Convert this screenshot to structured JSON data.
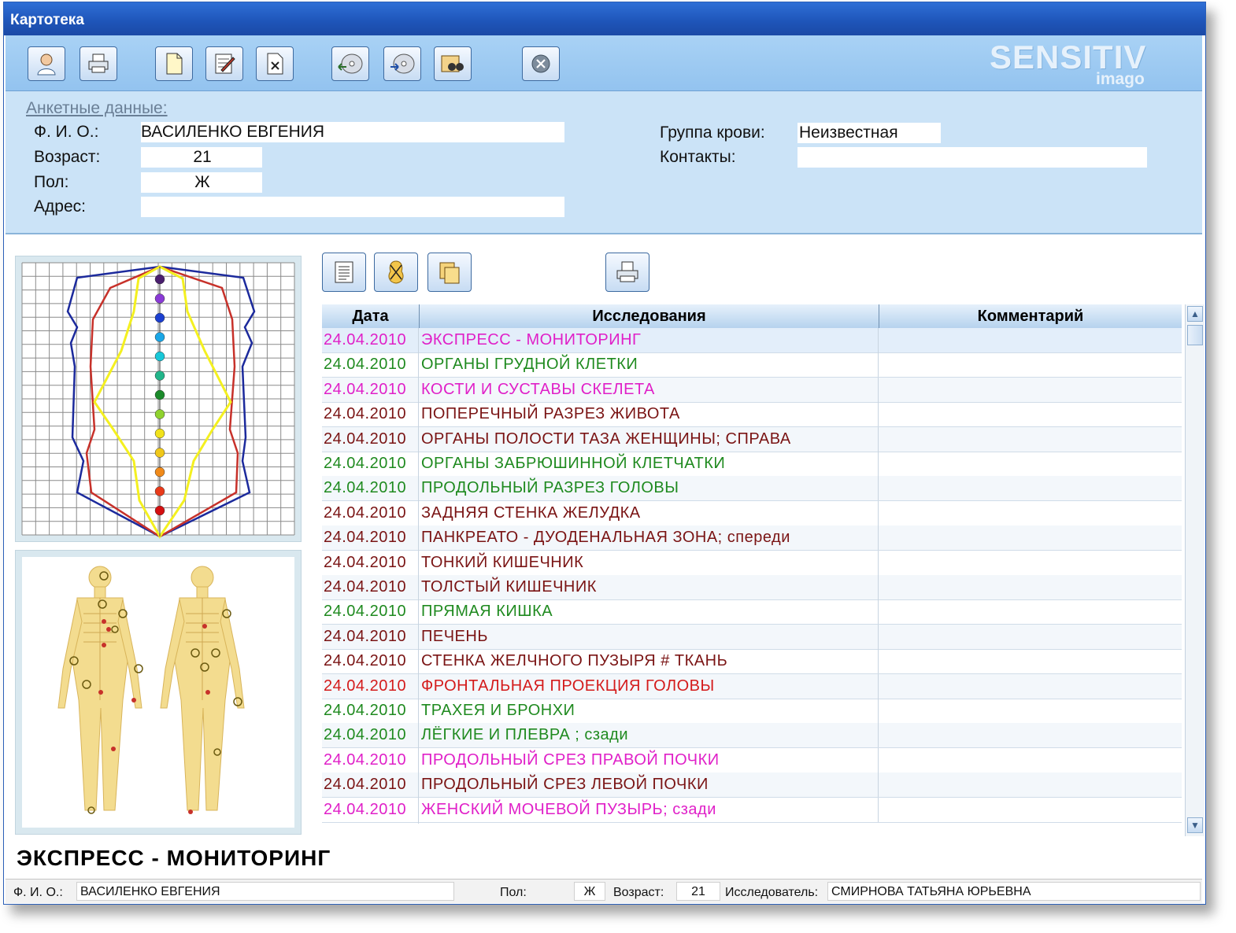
{
  "window": {
    "title": "Картотека"
  },
  "toolbar": {
    "buttons": [
      {
        "name": "patient-button",
        "icon": "person-icon"
      },
      {
        "name": "print-button",
        "icon": "printer-icon"
      },
      {
        "name": "new-button",
        "icon": "new-document-icon"
      },
      {
        "name": "edit-button",
        "icon": "edit-icon"
      },
      {
        "name": "delete-button",
        "icon": "delete-icon"
      },
      {
        "name": "import-button",
        "icon": "disk-import-icon"
      },
      {
        "name": "export-button",
        "icon": "disk-export-icon"
      },
      {
        "name": "search-button",
        "icon": "binoculars-icon"
      },
      {
        "name": "close-button",
        "icon": "close-icon"
      }
    ],
    "brand": "SENSITIV",
    "brand_sub": "imago"
  },
  "profile": {
    "section_title": "Анкетные данные:",
    "fio_label": "Ф. И. О.:",
    "fio_value": "ВАСИЛЕНКО ЕВГЕНИЯ",
    "age_label": "Возраст:",
    "age_value": "21",
    "sex_label": "Пол:",
    "sex_value": "Ж",
    "address_label": "Адрес:",
    "address_value": "",
    "blood_label": "Группа крови:",
    "blood_value": "Неизвестная",
    "contacts_label": "Контакты:",
    "contacts_value": ""
  },
  "detail_toolbar": {
    "buttons": [
      {
        "name": "list-button",
        "icon": "list-icon"
      },
      {
        "name": "body-button",
        "icon": "body-icon"
      },
      {
        "name": "copy-button",
        "icon": "copy-icon"
      },
      {
        "name": "print-study-button",
        "icon": "printer-icon"
      }
    ]
  },
  "table": {
    "headers": {
      "date": "Дата",
      "study": "Исследования",
      "comment": "Комментарий"
    },
    "rows": [
      {
        "date": "24.04.2010",
        "study": "ЭКСПРЕСС  -  МОНИТОРИНГ",
        "comment": "",
        "color": "#e020c8"
      },
      {
        "date": "24.04.2010",
        "study": "ОРГАНЫ  ГРУДНОЙ  КЛЕТКИ",
        "comment": "",
        "color": "#1f8a1f"
      },
      {
        "date": "24.04.2010",
        "study": "КОСТИ И СУСТАВЫ СКЕЛЕТА",
        "comment": "",
        "color": "#e020c8"
      },
      {
        "date": "24.04.2010",
        "study": "ПОПЕРЕЧНЫЙ РАЗРЕЗ ЖИВОТА",
        "comment": "",
        "color": "#7a1414"
      },
      {
        "date": "24.04.2010",
        "study": "ОРГАНЫ  ПОЛОСТИ ТАЗА  ЖЕНЩИНЫ;  СПРАВА",
        "comment": "",
        "color": "#7a1414"
      },
      {
        "date": "24.04.2010",
        "study": "ОРГАНЫ ЗАБРЮШИННОЙ КЛЕТЧАТКИ",
        "comment": "",
        "color": "#1f8a1f"
      },
      {
        "date": "24.04.2010",
        "study": "ПРОДОЛЬНЫЙ  РАЗРЕЗ  ГОЛОВЫ",
        "comment": "",
        "color": "#1f8a1f"
      },
      {
        "date": "24.04.2010",
        "study": "ЗАДНЯЯ  СТЕНКА ЖЕЛУДКА",
        "comment": "",
        "color": "#7a1414"
      },
      {
        "date": "24.04.2010",
        "study": "ПАНКРЕАТО - ДУОДЕНАЛЬНАЯ  ЗОНА;   спереди",
        "comment": "",
        "color": "#7a1414"
      },
      {
        "date": "24.04.2010",
        "study": "ТОНКИЙ  КИШЕЧНИК",
        "comment": "",
        "color": "#7a1414"
      },
      {
        "date": "24.04.2010",
        "study": "ТОЛСТЫЙ  КИШЕЧНИК",
        "comment": "",
        "color": "#7a1414"
      },
      {
        "date": "24.04.2010",
        "study": "ПРЯМАЯ  КИШКА",
        "comment": "",
        "color": "#1f8a1f"
      },
      {
        "date": "24.04.2010",
        "study": "ПЕЧЕНЬ",
        "comment": "",
        "color": "#7a1414"
      },
      {
        "date": "24.04.2010",
        "study": "СТЕНКА  ЖЕЛЧНОГО  ПУЗЫРЯ # ТКАНЬ",
        "comment": "",
        "color": "#7a1414"
      },
      {
        "date": "24.04.2010",
        "study": "ФРОНТАЛЬНАЯ  ПРОЕКЦИЯ  ГОЛОВЫ",
        "comment": "",
        "color": "#d41b1b"
      },
      {
        "date": "24.04.2010",
        "study": "ТРАХЕЯ  И  БРОНХИ",
        "comment": "",
        "color": "#1f8a1f"
      },
      {
        "date": "24.04.2010",
        "study": "ЛЁГКИЕ  И  ПЛЕВРА ;  сзади",
        "comment": "",
        "color": "#1f8a1f"
      },
      {
        "date": "24.04.2010",
        "study": "ПРОДОЛЬНЫЙ  СРЕЗ   ПРАВОЙ  ПОЧКИ",
        "comment": "",
        "color": "#e020c8"
      },
      {
        "date": "24.04.2010",
        "study": "ПРОДОЛЬНЫЙ  СРЕЗ  ЛЕВОЙ  ПОЧКИ",
        "comment": "",
        "color": "#7a1414"
      },
      {
        "date": "24.04.2010",
        "study": "ЖЕНСКИЙ  МОЧЕВОЙ  ПУЗЫРЬ;  сзади",
        "comment": "",
        "color": "#e020c8"
      }
    ]
  },
  "selected_study": "ЭКСПРЕСС  -  МОНИТОРИНГ",
  "status": {
    "fio_label": "Ф. И. О.:",
    "fio_value": "ВАСИЛЕНКО ЕВГЕНИЯ",
    "sex_label": "Пол:",
    "sex_value": "Ж",
    "age_label": "Возраст:",
    "age_value": "21",
    "researcher_label": "Исследователь:",
    "researcher_value": "СМИРНОВА ТАТЬЯНА ЮРЬЕВНА"
  },
  "chakra_colors": [
    "#4a1f6e",
    "#8a3ad6",
    "#1c3fd0",
    "#1aa6e6",
    "#18c7d8",
    "#22b58a",
    "#1a8a2a",
    "#8fd22e",
    "#f1e21c",
    "#f0c81a",
    "#f08a1a",
    "#e83a1a",
    "#d41010"
  ]
}
